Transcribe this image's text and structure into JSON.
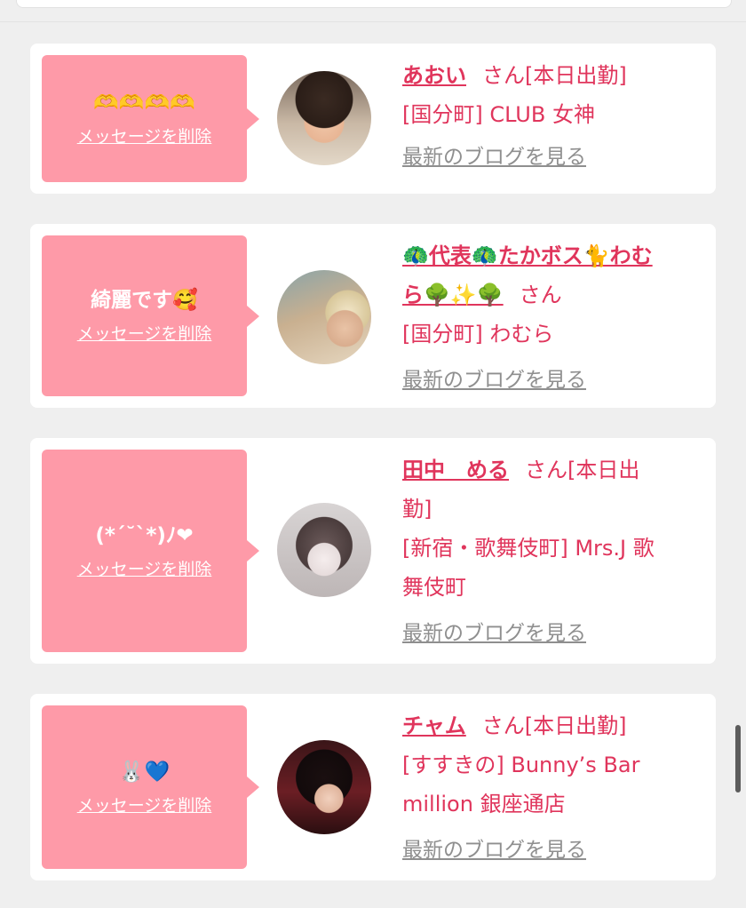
{
  "delete_label": "メッセージを削除",
  "blog_label": "最新のブログを見る",
  "san_label": "さん",
  "entries": [
    {
      "message": "🫶🫶🫶🫶",
      "name": "あおい",
      "status": "[本日出勤]",
      "shop": "[国分町] CLUB 女神"
    },
    {
      "message": "綺麗です🥰",
      "name_line1": "🦚代表🦚たかボス🐈わむ",
      "name_line2": "ら🌳✨🌳",
      "status": "",
      "shop": "[国分町] わむら"
    },
    {
      "message": "(*´˘`*)ﾉ❤︎",
      "name": "田中　める",
      "status": "[本日出",
      "status_cont": "勤]",
      "shop_line1": "[新宿・歌舞伎町] Mrs.J 歌",
      "shop_line2": "舞伎町"
    },
    {
      "message": "🐰💙",
      "name": "チャム",
      "status": "[本日出勤]",
      "shop_line1": "[すすきの] Bunny’s Bar",
      "shop_line2": "million 銀座通店"
    }
  ]
}
